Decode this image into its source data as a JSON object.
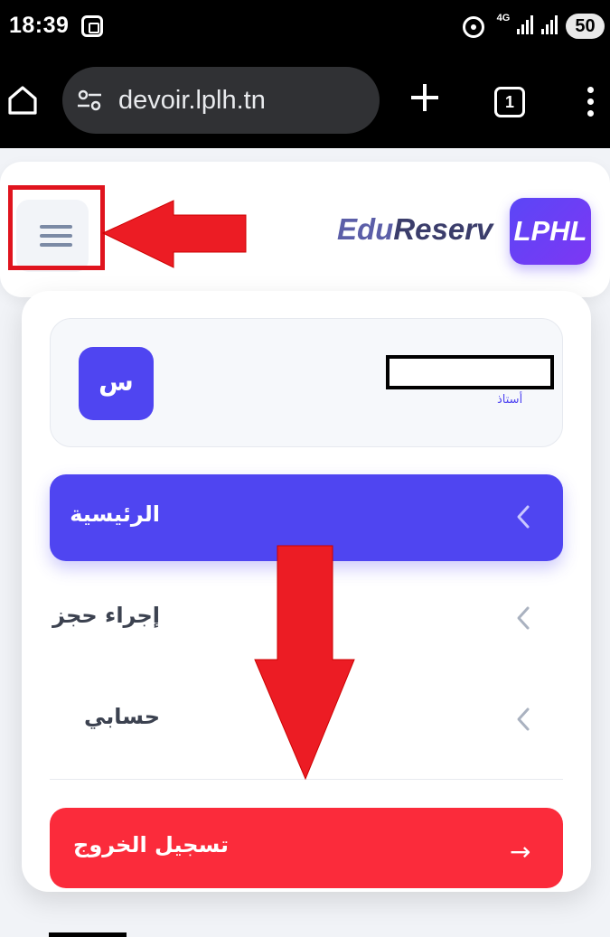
{
  "status_bar": {
    "time": "18:39",
    "network": "4G",
    "battery": "50"
  },
  "browser": {
    "url": "devoir.lplh.tn",
    "tab_count": "1"
  },
  "header": {
    "brand_part1": "Edu",
    "brand_part2": "Reserv",
    "logo_text": "LPHL"
  },
  "drawer": {
    "avatar_letter": "س",
    "role": "أستاذ",
    "nav": [
      {
        "label": "الرئيسية",
        "active": true
      },
      {
        "label": "إجراء حجز",
        "active": false
      },
      {
        "label": "حسابي",
        "active": false
      }
    ],
    "logout_label": "تسجيل الخروج",
    "logout_arrow": "→"
  },
  "colors": {
    "accent": "#4f45f1",
    "danger": "#fb2b3b",
    "annotation": "#e0141e"
  }
}
